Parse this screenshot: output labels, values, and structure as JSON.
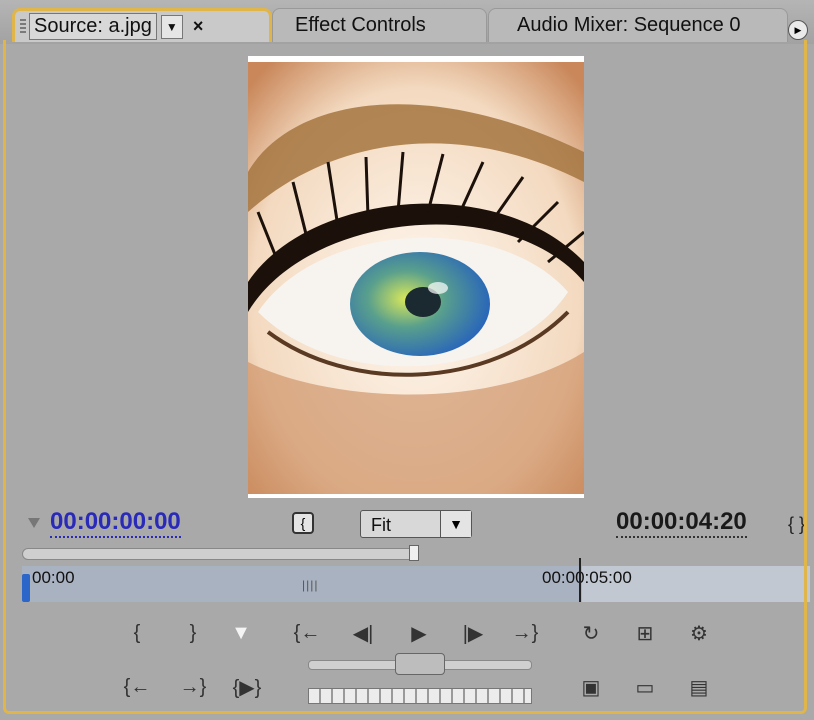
{
  "tabs": {
    "source": {
      "label": "Source: a.jpg",
      "close": "×"
    },
    "effect_controls": {
      "label": "Effect Controls"
    },
    "audio_mixer": {
      "label": "Audio Mixer: Sequence 0"
    }
  },
  "viewer": {
    "image_name": "a.jpg"
  },
  "timecode": {
    "current": "00:00:00:00",
    "duration": "00:00:04:20"
  },
  "zoom": {
    "value": "Fit"
  },
  "ruler": {
    "start_label": "00:00",
    "mid_label": "00:00:05:00"
  },
  "icons": {
    "set_in": "{",
    "set_out": "}",
    "marker": "▼",
    "goto_in": "{←",
    "step_back": "◀|",
    "play": "▶",
    "step_fwd": "|▶",
    "goto_out": "→}",
    "loop": "↻",
    "safe_margins": "⊞",
    "output": "⚙",
    "goto_prev": "{←",
    "goto_next": "→}",
    "play_in_out": "{▶}",
    "insert": "▣",
    "overlay": "▭",
    "export_frame": "▤"
  }
}
